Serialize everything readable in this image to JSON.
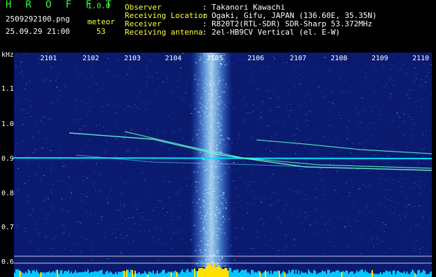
{
  "header": {
    "logo": "H R O F F T",
    "version": "1.0.0",
    "filename": "2509292100.png",
    "datetime": "25.09.29 21:00",
    "meteor_label": "meteor",
    "meteor_count": "53",
    "fields": [
      {
        "label": "Observer",
        "value": ": Takanori Kawachi"
      },
      {
        "label": "Receiving Location",
        "value": ": Ogaki, Gifu, JAPAN (136.60E, 35.35N)"
      },
      {
        "label": "Receiver",
        "value": ": R820T2(RTL-SDR) SDR-Sharp 53.372MHz"
      },
      {
        "label": "Receiving antenna",
        "value": ": 2el-HB9CV Vertical (el. E-W)"
      }
    ]
  },
  "axes": {
    "y_unit": "kHz",
    "y_ticks": [
      "1.1",
      "1.0",
      "0.9",
      "0.8",
      "0.7",
      "0.6"
    ],
    "x_ticks": [
      "2101",
      "2102",
      "2103",
      "2104",
      "2105",
      "2106",
      "2107",
      "2108",
      "2109",
      "2110"
    ]
  },
  "colors": {
    "background": "#0a1a6e",
    "noise": "#2a57d6",
    "carrier": "#00e0ff",
    "meteor": "#66ffcc",
    "spectrum_fill": "#00c8ff",
    "spectrum_peak": "#ffe000"
  }
}
